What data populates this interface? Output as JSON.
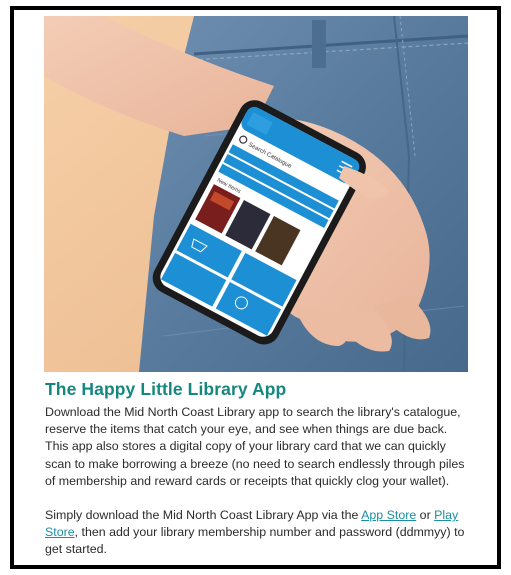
{
  "article": {
    "title": "The Happy Little Library App",
    "paragraph1": "Download the Mid North Coast Library app to search the library's catalogue, reserve the items that catch your eye, and see when things are due back. This app also stores a digital copy of your library card that we can quickly scan to make borrowing a breeze (no need to search endlessly through piles of membership and reward cards or receipts that quickly clog your wallet).",
    "paragraph2_before": "Simply download the Mid North Coast Library App via the ",
    "app_store_link": "App Store",
    "paragraph2_or": " or ",
    "play_store_link": "Play Store",
    "paragraph2_after": ", then add your library membership number and password (ddmmyy) to get started."
  },
  "phone_screen": {
    "search_placeholder": "Search Catalogue",
    "new_items_label": "New Items"
  },
  "colors": {
    "title": "#14877e",
    "link": "#1a8fa3",
    "app_blue": "#1d8fd4",
    "background_peach": "#f2c499",
    "denim": "#5d7fa1"
  }
}
